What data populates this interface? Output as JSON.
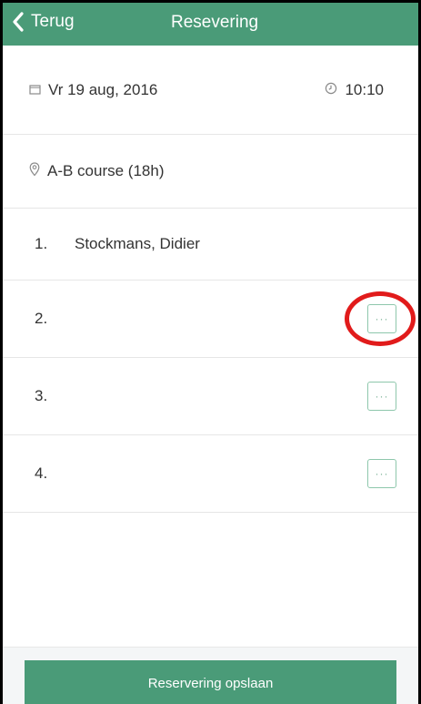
{
  "header": {
    "back_label": "Terug",
    "title": "Resevering"
  },
  "reservation": {
    "date": "Vr 19 aug, 2016",
    "time": "10:10",
    "course": "A-B course (18h)"
  },
  "players": [
    {
      "number": "1.",
      "name": "Stockmans, Didier"
    },
    {
      "number": "2.",
      "name": "",
      "more_label": "···"
    },
    {
      "number": "3.",
      "name": "",
      "more_label": "···"
    },
    {
      "number": "4.",
      "name": "",
      "more_label": "···"
    }
  ],
  "footer": {
    "save_label": "Reservering opslaan"
  },
  "colors": {
    "accent": "#4a9b78",
    "highlight": "#e11b1b"
  },
  "icons": {
    "back": "chevron-left-icon",
    "date": "calendar-icon",
    "time": "clock-icon",
    "course": "location-pin-icon"
  }
}
